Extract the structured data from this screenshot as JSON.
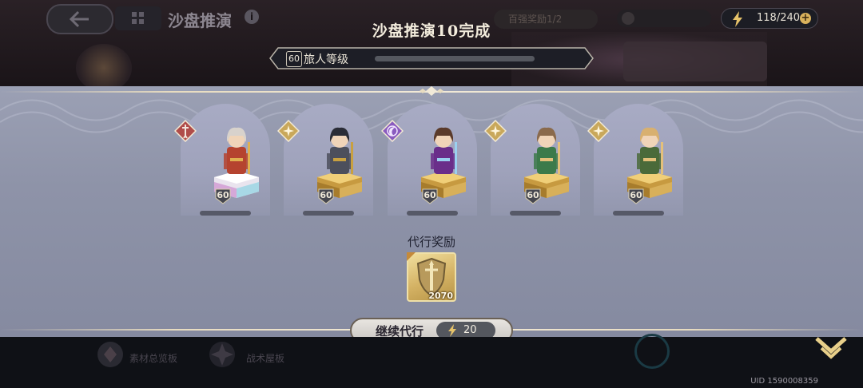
{
  "header": {
    "dim_title": "沙盘推演",
    "dim_pill_text": "百强奖励1/2",
    "energy": "118/240",
    "accent_gold": "#d9b25c"
  },
  "result": {
    "title": "沙盘推演10完成",
    "traveler_level_value": "60",
    "traveler_level_label": "旅人等级",
    "traveler_level_progress": 0
  },
  "heroes": [
    {
      "name": "hero-1",
      "element": "sword",
      "element_color": "#b04d4a",
      "level": "60",
      "pedestal": "crystal"
    },
    {
      "name": "hero-2",
      "element": "light",
      "element_color": "#c9a85b",
      "level": "60",
      "pedestal": "gold"
    },
    {
      "name": "hero-3",
      "element": "dark",
      "element_color": "#8a5bbf",
      "level": "60",
      "pedestal": "gold"
    },
    {
      "name": "hero-4",
      "element": "light",
      "element_color": "#c9a85b",
      "level": "60",
      "pedestal": "gold"
    },
    {
      "name": "hero-5",
      "element": "light",
      "element_color": "#c9a85b",
      "level": "60",
      "pedestal": "gold"
    }
  ],
  "reward": {
    "title": "代行奖励",
    "item_icon": "shield-sword-icon",
    "item_count": "2070"
  },
  "continue_button": {
    "label": "继续代行",
    "cost": "20"
  },
  "footer": {
    "uid": "UID 1590008359",
    "dim_item_1": "素材总览板",
    "dim_item_2": "战术屋板"
  }
}
